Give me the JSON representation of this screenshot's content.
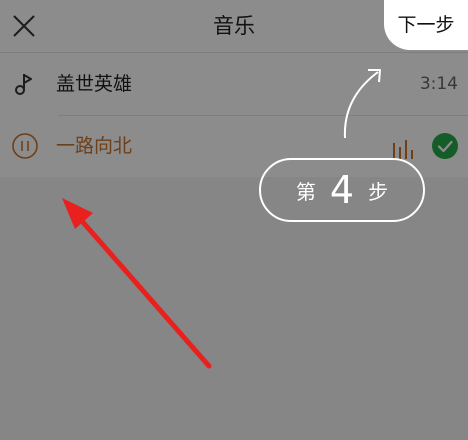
{
  "header": {
    "title": "音乐",
    "close_icon": "close-icon"
  },
  "songs": [
    {
      "name": "盖世英雄",
      "duration": "3:14",
      "icon": "music-note-icon",
      "playing": false
    },
    {
      "name": "一路向北",
      "duration": "",
      "icon": "pause-icon",
      "playing": true,
      "status_icons": [
        "equalizer-icon",
        "check-circle-icon"
      ]
    }
  ],
  "guide": {
    "next_step_label": "下一步",
    "step_prefix": "第",
    "step_number": "4",
    "step_suffix": "步"
  },
  "colors": {
    "playing_text": "#c87530",
    "check_green": "#27a94a",
    "arrow_red": "#e8201e",
    "overlay": "rgba(0,0,0,0.45)"
  }
}
